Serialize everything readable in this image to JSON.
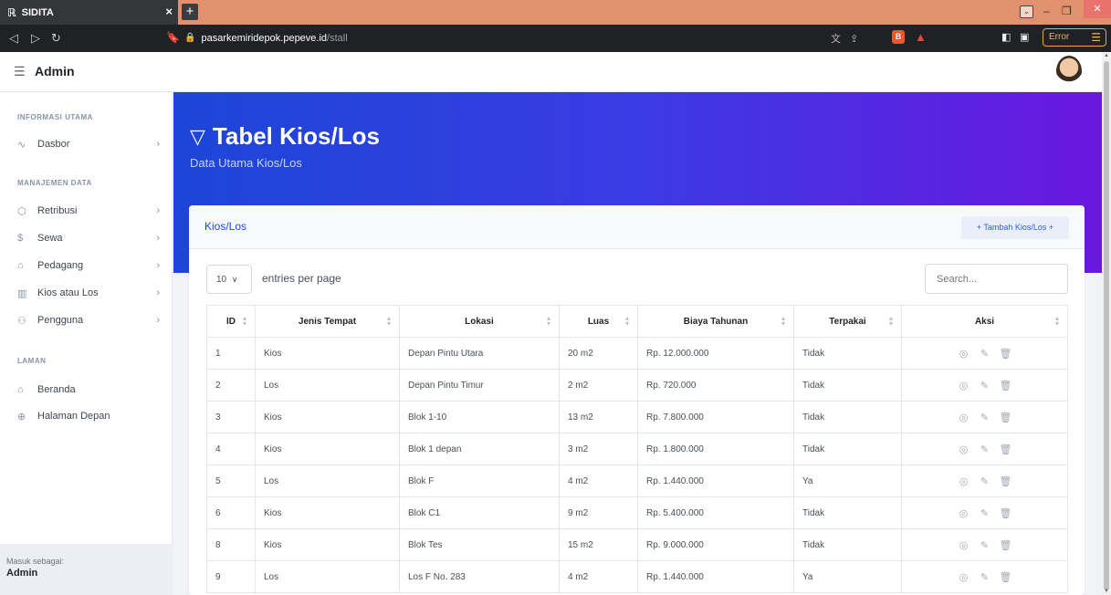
{
  "browser": {
    "tab_title": "SIDITA",
    "tab_logo": "ℝ",
    "url_host": "pasarkemiridepok.pepeve.id",
    "url_path": "/stall",
    "error_label": "Error"
  },
  "header": {
    "brand": "Admin"
  },
  "sidebar": {
    "sections": [
      {
        "heading": "INFORMASI UTAMA"
      },
      {
        "heading": "MANAJEMEN DATA"
      },
      {
        "heading": "LAMAN"
      }
    ],
    "items": [
      {
        "label": "Dasbor",
        "icon": "activity-icon"
      },
      {
        "label": "Retribusi",
        "icon": "cube-icon"
      },
      {
        "label": "Sewa",
        "icon": "dollar-icon"
      },
      {
        "label": "Pedagang",
        "icon": "store-icon"
      },
      {
        "label": "Kios atau Los",
        "icon": "shop-icon"
      },
      {
        "label": "Pengguna",
        "icon": "users-icon"
      },
      {
        "label": "Beranda",
        "icon": "home-icon"
      },
      {
        "label": "Halaman Depan",
        "icon": "globe-icon"
      }
    ],
    "footer_label": "Masuk sebagai:",
    "footer_user": "Admin"
  },
  "hero": {
    "title": "Tabel Kios/Los",
    "subtitle": "Data Utama Kios/Los"
  },
  "card": {
    "title": "Kios/Los",
    "add_button": "+ Tambah Kios/Los +",
    "per_page_value": "10",
    "per_page_label": "entries per page",
    "search_placeholder": "Search..."
  },
  "table": {
    "columns": [
      "ID",
      "Jenis Tempat",
      "Lokasi",
      "Luas",
      "Biaya Tahunan",
      "Terpakai",
      "Aksi"
    ],
    "rows": [
      [
        "1",
        "Kios",
        "Depan Pintu Utara",
        "20 m2",
        "Rp. 12.000.000",
        "Tidak"
      ],
      [
        "2",
        "Los",
        "Depan Pintu Timur",
        "2 m2",
        "Rp. 720.000",
        "Tidak"
      ],
      [
        "3",
        "Kios",
        "Blok 1-10",
        "13 m2",
        "Rp. 7.800.000",
        "Tidak"
      ],
      [
        "4",
        "Kios",
        "Blok 1 depan",
        "3 m2",
        "Rp. 1.800.000",
        "Tidak"
      ],
      [
        "5",
        "Los",
        "Blok F",
        "4 m2",
        "Rp. 1.440.000",
        "Ya"
      ],
      [
        "6",
        "Kios",
        "Blok C1",
        "9 m2",
        "Rp. 5.400.000",
        "Tidak"
      ],
      [
        "8",
        "Kios",
        "Blok Tes",
        "15 m2",
        "Rp. 9.000.000",
        "Tidak"
      ],
      [
        "9",
        "Los",
        "Los F No. 283",
        "4 m2",
        "Rp. 1.440.000",
        "Ya"
      ]
    ]
  },
  "colors": {
    "accent": "#1e4bd8",
    "hero_start": "#1c46d8",
    "hero_end": "#6a17e0"
  }
}
